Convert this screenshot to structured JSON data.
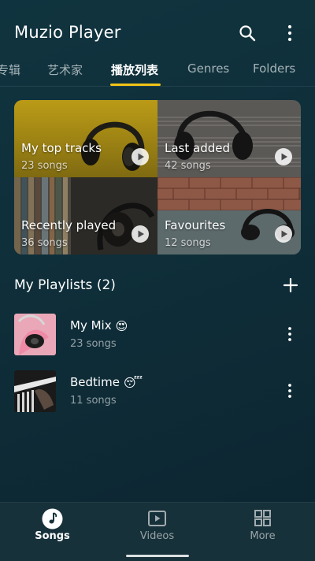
{
  "app": {
    "title": "Muzio Player",
    "search_icon": "search-icon",
    "menu_icon": "more-vertical-icon"
  },
  "tabs": [
    {
      "label": "专辑",
      "active": false
    },
    {
      "label": "艺术家",
      "active": false
    },
    {
      "label": "播放列表",
      "active": true
    },
    {
      "label": "Genres",
      "active": false
    },
    {
      "label": "Folders",
      "active": false
    }
  ],
  "smart_playlists": [
    {
      "label": "My top tracks",
      "count": "23 songs"
    },
    {
      "label": "Last added",
      "count": "42 songs"
    },
    {
      "label": "Recently played",
      "count": "36 songs"
    },
    {
      "label": "Favourites",
      "count": "12 songs"
    }
  ],
  "my_playlists": {
    "title": "My Playlists (2)",
    "add_icon": "plus-icon",
    "items": [
      {
        "name": "My Mix",
        "emoji": "😍",
        "count": "23 songs"
      },
      {
        "name": "Bedtime",
        "emoji": "😴",
        "count": "11 songs"
      }
    ]
  },
  "bottom_nav": [
    {
      "label": "Songs",
      "icon": "music-note-icon",
      "active": true
    },
    {
      "label": "Videos",
      "icon": "video-play-icon",
      "active": false
    },
    {
      "label": "More",
      "icon": "grid-icon",
      "active": false
    }
  ],
  "colors": {
    "accent": "#f2c418",
    "background": "#10343f",
    "nav_bar": "#17313a"
  }
}
